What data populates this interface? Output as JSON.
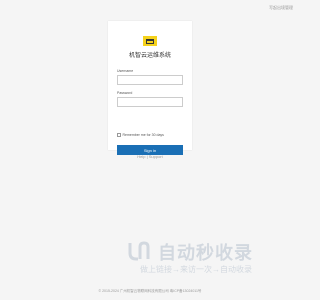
{
  "header": {
    "top_link": "写起出境管理"
  },
  "login": {
    "title": "机智云运维系统",
    "username_label": "Username",
    "username_value": "",
    "password_label": "Password",
    "password_value": "",
    "remember_label": "Remember me for 30 days",
    "remember_checked": false,
    "signin_label": "Sign in"
  },
  "help": {
    "text": "Help | Support"
  },
  "watermark": {
    "title": "自动秒收录",
    "subtitle": "做上链接→来访一次→自动收录"
  },
  "footer": {
    "text": "© 2015-2024 广州机智云物联网科技有限公司 粤ICP备13024011号"
  },
  "colors": {
    "accent": "#1a6fb5",
    "logo": "#f5d21c",
    "background": "#f5f5f5"
  }
}
